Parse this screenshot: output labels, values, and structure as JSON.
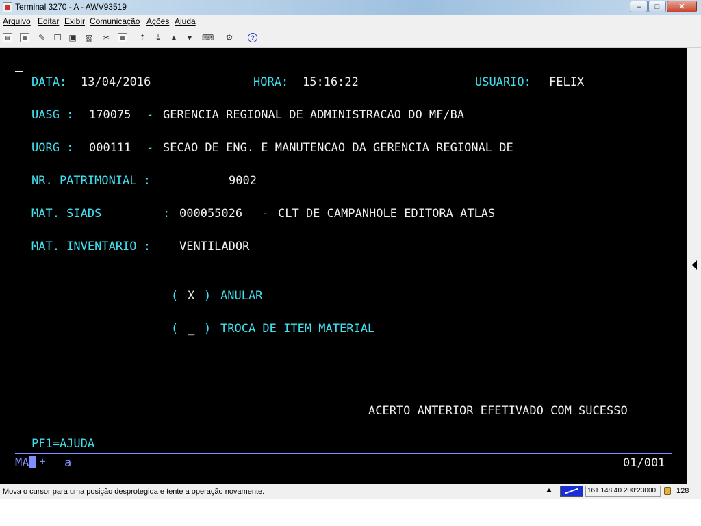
{
  "window": {
    "title": "Terminal 3270 - A - AWV93519",
    "minimize_glyph": "–",
    "maximize_glyph": "□",
    "close_glyph": "✕"
  },
  "menu": [
    "Arquivo",
    "Editar",
    "Exibir",
    "Comunicação",
    "Ações",
    "Ajuda"
  ],
  "toolbar": {
    "icons": [
      "print-icon",
      "print-screen-icon",
      "edit-icon",
      "copy-icon",
      "paste-icon",
      "paste-special-icon",
      "macro-icon",
      "keypad-icon",
      "send-file-icon",
      "receive-file-icon",
      "upload-icon",
      "download-icon",
      "keyboard-icon",
      "settings-icon",
      "help-icon"
    ],
    "help_glyph": "?"
  },
  "screen": {
    "data_label": "DATA:",
    "data_value": "13/04/2016",
    "hora_label": "HORA:",
    "hora_value": "15:16:22",
    "usuario_label": "USUARIO:",
    "usuario_value": "FELIX",
    "uasg_label": "UASG :",
    "uasg_code": "170075",
    "uasg_dash": "-",
    "uasg_name": "GERENCIA REGIONAL DE ADMINISTRACAO DO MF/BA",
    "uorg_label": "UORG :",
    "uorg_code": "000111",
    "uorg_dash": "-",
    "uorg_name": "SECAO DE ENG. E MANUTENCAO DA GERENCIA REGIONAL DE",
    "patrimonial_label": "NR. PATRIMONIAL :",
    "patrimonial_value": "9002",
    "siads_label": "MAT. SIADS",
    "siads_colon": ":",
    "siads_code": "000055026",
    "siads_dash": "-",
    "siads_desc": "CLT DE CAMPANHOLE EDITORA ATLAS",
    "inventario_label": "MAT. INVENTARIO :",
    "inventario_value": "VENTILADOR",
    "option1_open": "(",
    "option1_mark": "X",
    "option1_close": ")",
    "option1_label": "ANULAR",
    "option2_open": "(",
    "option2_mark": "_",
    "option2_close": ")",
    "option2_label": "TROCA DE ITEM MATERIAL",
    "message": "ACERTO ANTERIOR EFETIVADO COM SUCESSO",
    "pf_help": "PF1=AJUDA"
  },
  "oia": {
    "indicator": "MA",
    "plus": "+",
    "letter": "a",
    "page": "01/001",
    "color": "#7f8fff"
  },
  "status": {
    "message": "Mova o cursor para uma posição desprotegida e tente a operação novamente.",
    "host": "161.148.40.200:23000",
    "bits": "128"
  },
  "colors": {
    "field_label": "#41e0f0",
    "field_value": "#f0f0f0",
    "terminal_bg": "#000000"
  }
}
